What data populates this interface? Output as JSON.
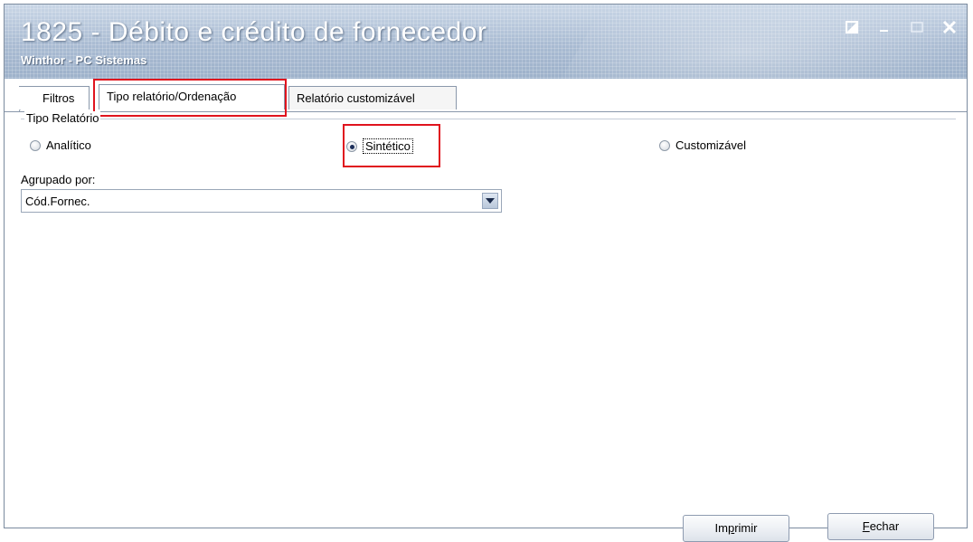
{
  "window": {
    "title": "1825 - Débito e crédito de fornecedor",
    "subtitle": "Winthor - PC Sistemas"
  },
  "tabs": [
    {
      "label": "Filtros"
    },
    {
      "label": "Tipo relatório/Ordenação",
      "selected": true
    },
    {
      "label": "Relatório customizável"
    }
  ],
  "tipo_relatorio": {
    "group_label": "Tipo Relatório",
    "options": [
      {
        "label": "Analítico",
        "checked": false
      },
      {
        "label": "Sintético",
        "checked": true
      },
      {
        "label": "Customizável",
        "checked": false
      }
    ]
  },
  "agrupado_por": {
    "label": "Agrupado por:",
    "value": "Cód.Fornec."
  },
  "buttons": {
    "imprimir": {
      "before": "Im",
      "accel": "p",
      "after": "rimir"
    },
    "fechar": {
      "before": "",
      "accel": "F",
      "after": "echar"
    }
  },
  "colors": {
    "highlight": "#e0141e",
    "title_bg": "#a9bbd2"
  }
}
